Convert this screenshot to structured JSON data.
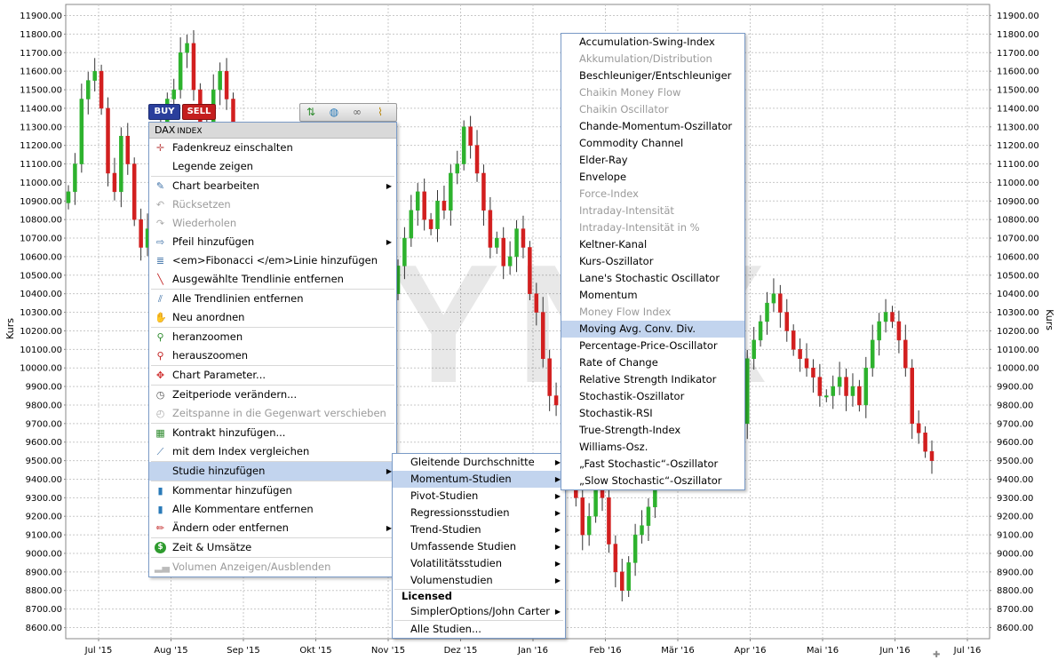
{
  "chart_data": {
    "type": "candlestick",
    "watermark": "LYNX",
    "ylabel_left": "Kurs",
    "ylabel_right": "Kurs",
    "ylim": [
      8540,
      11960
    ],
    "y_ticks": [
      "11900.00",
      "11800.00",
      "11700.00",
      "11600.00",
      "11500.00",
      "11400.00",
      "11300.00",
      "11200.00",
      "11100.00",
      "11000.00",
      "10900.00",
      "10800.00",
      "10700.00",
      "10600.00",
      "10500.00",
      "10400.00",
      "10300.00",
      "10200.00",
      "10100.00",
      "10000.00",
      "9900.00",
      "9800.00",
      "9700.00",
      "9600.00",
      "9500.00",
      "9400.00",
      "9300.00",
      "9200.00",
      "9100.00",
      "9000.00",
      "8900.00",
      "8800.00",
      "8700.00",
      "8600.00"
    ],
    "x_ticks": [
      "Jul '15",
      "Aug '15",
      "Sep '15",
      "Okt '15",
      "Nov '15",
      "Dez '15",
      "Jan '16",
      "Feb '16",
      "Mär '16",
      "Apr '16",
      "Mai '16",
      "Jun '16",
      "Jul '16"
    ],
    "up_color": "#2db22d",
    "down_color": "#d21f1f",
    "closes": [
      10950,
      11100,
      11450,
      11550,
      11600,
      11400,
      11050,
      10950,
      11250,
      11100,
      10800,
      10650,
      10750,
      11000,
      11300,
      11450,
      11500,
      11700,
      11750,
      11500,
      11300,
      11250,
      11500,
      11600,
      11450,
      11200,
      11050,
      10900,
      10950,
      10750,
      10700,
      10850,
      10850,
      10750,
      10800,
      10900,
      10700,
      10400,
      10200,
      10150,
      10300,
      10500,
      10250,
      10050,
      9900,
      9800,
      9950,
      10150,
      10300,
      10400,
      10550,
      10700,
      10850,
      10950,
      10800,
      10750,
      10900,
      10850,
      11050,
      11100,
      11300,
      11200,
      11050,
      10850,
      10650,
      10700,
      10550,
      10600,
      10750,
      10650,
      10400,
      10300,
      10050,
      9850,
      9800,
      9650,
      9500,
      9300,
      9100,
      9200,
      9400,
      9300,
      9050,
      8900,
      8800,
      8950,
      9100,
      9150,
      9250,
      9400,
      9550,
      9750,
      9850,
      9950,
      10000,
      10050,
      9900,
      9850,
      9750,
      9700,
      9550,
      9600,
      9700,
      10050,
      10150,
      10250,
      10350,
      10400,
      10300,
      10200,
      10100,
      10050,
      10000,
      9950,
      9850,
      9850,
      9900,
      9950,
      9850,
      9900,
      9800,
      10000,
      10150,
      10250,
      10300,
      10250,
      10150,
      10000,
      9700,
      9650,
      9550,
      9500
    ]
  },
  "toolbar": {
    "buy_label": "BUY",
    "sell_label": "SELL",
    "buy_color": "#2a3f9c",
    "sell_color": "#c41e1e"
  },
  "context_menu": {
    "header_title": "DAX",
    "header_sub": "INDEX",
    "items": [
      {
        "label": "Fadenkreuz einschalten",
        "icon": "crosshair-icon",
        "glyph": "✛",
        "color": "#c05050"
      },
      {
        "label": "Legende zeigen",
        "icon": "",
        "glyph": "",
        "color": "#000"
      },
      {
        "label": "Chart bearbeiten",
        "icon": "edit-chart-icon",
        "glyph": "✎",
        "color": "#3a6ea5",
        "arrow": "▶"
      },
      {
        "label": "Rücksetzen",
        "icon": "reset-icon",
        "glyph": "↶",
        "color": "#aaa"
      },
      {
        "label": "Wiederholen",
        "icon": "redo-icon",
        "glyph": "↷",
        "color": "#aaa"
      },
      {
        "label": "Pfeil hinzufügen",
        "icon": "arrow-add-icon",
        "glyph": "⇨",
        "color": "#3a6ea5",
        "arrow": "▶"
      },
      {
        "label": "<em>Fibonacci </em>Linie hinzufügen",
        "icon": "fibonacci-icon",
        "glyph": "≣",
        "color": "#3a6ea5"
      },
      {
        "label": "Ausgewählte Trendlinie entfernen",
        "icon": "trendline-remove-icon",
        "glyph": "╲",
        "color": "#c02020"
      },
      {
        "label": "Alle Trendlinien entfernen",
        "icon": "trendlines-remove-all-icon",
        "glyph": "⫽",
        "color": "#3a6ea5"
      },
      {
        "label": "Neu anordnen",
        "icon": "hand-icon",
        "glyph": "✋",
        "color": "#555"
      },
      {
        "label": "heranzoomen",
        "icon": "zoom-in-icon",
        "glyph": "⚲",
        "color": "#2e8b2e"
      },
      {
        "label": "herauszoomen",
        "icon": "zoom-out-icon",
        "glyph": "⚲",
        "color": "#c02020"
      },
      {
        "label": "Chart Parameter...",
        "icon": "chart-parameter-icon",
        "glyph": "✥",
        "color": "#d03030"
      },
      {
        "label": "Zeitperiode verändern...",
        "icon": "clock-icon",
        "glyph": "◷",
        "color": "#555"
      },
      {
        "label": "Zeitspanne in die Gegenwart verschieben",
        "icon": "time-shift-icon",
        "glyph": "◴",
        "color": "#aaa"
      },
      {
        "label": "Kontrakt hinzufügen...",
        "icon": "contract-add-icon",
        "glyph": "▦",
        "color": "#2e8b2e"
      },
      {
        "label": "mit dem Index vergleichen",
        "icon": "compare-index-icon",
        "glyph": "⟋",
        "color": "#3a6ea5"
      },
      {
        "label": "Studie hinzufügen",
        "icon": "",
        "glyph": "",
        "color": "#000",
        "arrow": "▶"
      },
      {
        "label": "Kommentar hinzufügen",
        "icon": "comment-add-icon",
        "glyph": "▮",
        "color": "#2a7ab8"
      },
      {
        "label": "Alle Kommentare entfernen",
        "icon": "comments-remove-icon",
        "glyph": "▮",
        "color": "#2a7ab8"
      },
      {
        "label": "Ändern oder entfernen",
        "icon": "pencil-icon",
        "glyph": "✏",
        "color": "#c02020",
        "arrow": "▶"
      },
      {
        "label": "Zeit & Umsätze",
        "icon": "time-sales-icon",
        "glyph": "$",
        "color": "#fff"
      },
      {
        "label": "Volumen Anzeigen/Ausblenden",
        "icon": "volume-icon",
        "glyph": "▂▄",
        "color": "#bbb"
      }
    ]
  },
  "study_menu": {
    "items": [
      {
        "label": "Gleitende Durchschnitte",
        "arrow": "▶"
      },
      {
        "label": "Momentum-Studien",
        "arrow": "▶"
      },
      {
        "label": "Pivot-Studien",
        "arrow": "▶"
      },
      {
        "label": "Regressionsstudien",
        "arrow": "▶"
      },
      {
        "label": "Trend-Studien",
        "arrow": "▶"
      },
      {
        "label": "Umfassende Studien",
        "arrow": "▶"
      },
      {
        "label": "Volatilitätsstudien",
        "arrow": "▶"
      },
      {
        "label": "Volumenstudien",
        "arrow": "▶"
      }
    ],
    "section_header": "Licensed",
    "licensed_item": "SimplerOptions/John Carter",
    "licensed_arrow": "▶",
    "all_studies": "Alle Studien..."
  },
  "momentum_menu": {
    "items": [
      "Accumulation-Swing-Index",
      "Akkumulation/Distribution",
      "Beschleuniger/Entschleuniger",
      "Chaikin Money Flow",
      "Chaikin Oscillator",
      "Chande-Momentum-Oszillator",
      "Commodity Channel",
      "Elder-Ray",
      "Envelope",
      "Force-Index",
      "Intraday-Intensität",
      "Intraday-Intensität in %",
      "Keltner-Kanal",
      "Kurs-Oszillator",
      "Lane's Stochastic Oscillator",
      "Momentum",
      "Money Flow Index",
      "Moving Avg. Conv. Div.",
      "Percentage-Price-Oscillator",
      "Rate of Change",
      "Relative Strength Indikator",
      "Stochastik-Oszillator",
      "Stochastik-RSI",
      "True-Strength-Index",
      "Williams-Osz.",
      "„Fast Stochastic“-Oszillator",
      "„Slow Stochastic“-Oszillator"
    ]
  }
}
